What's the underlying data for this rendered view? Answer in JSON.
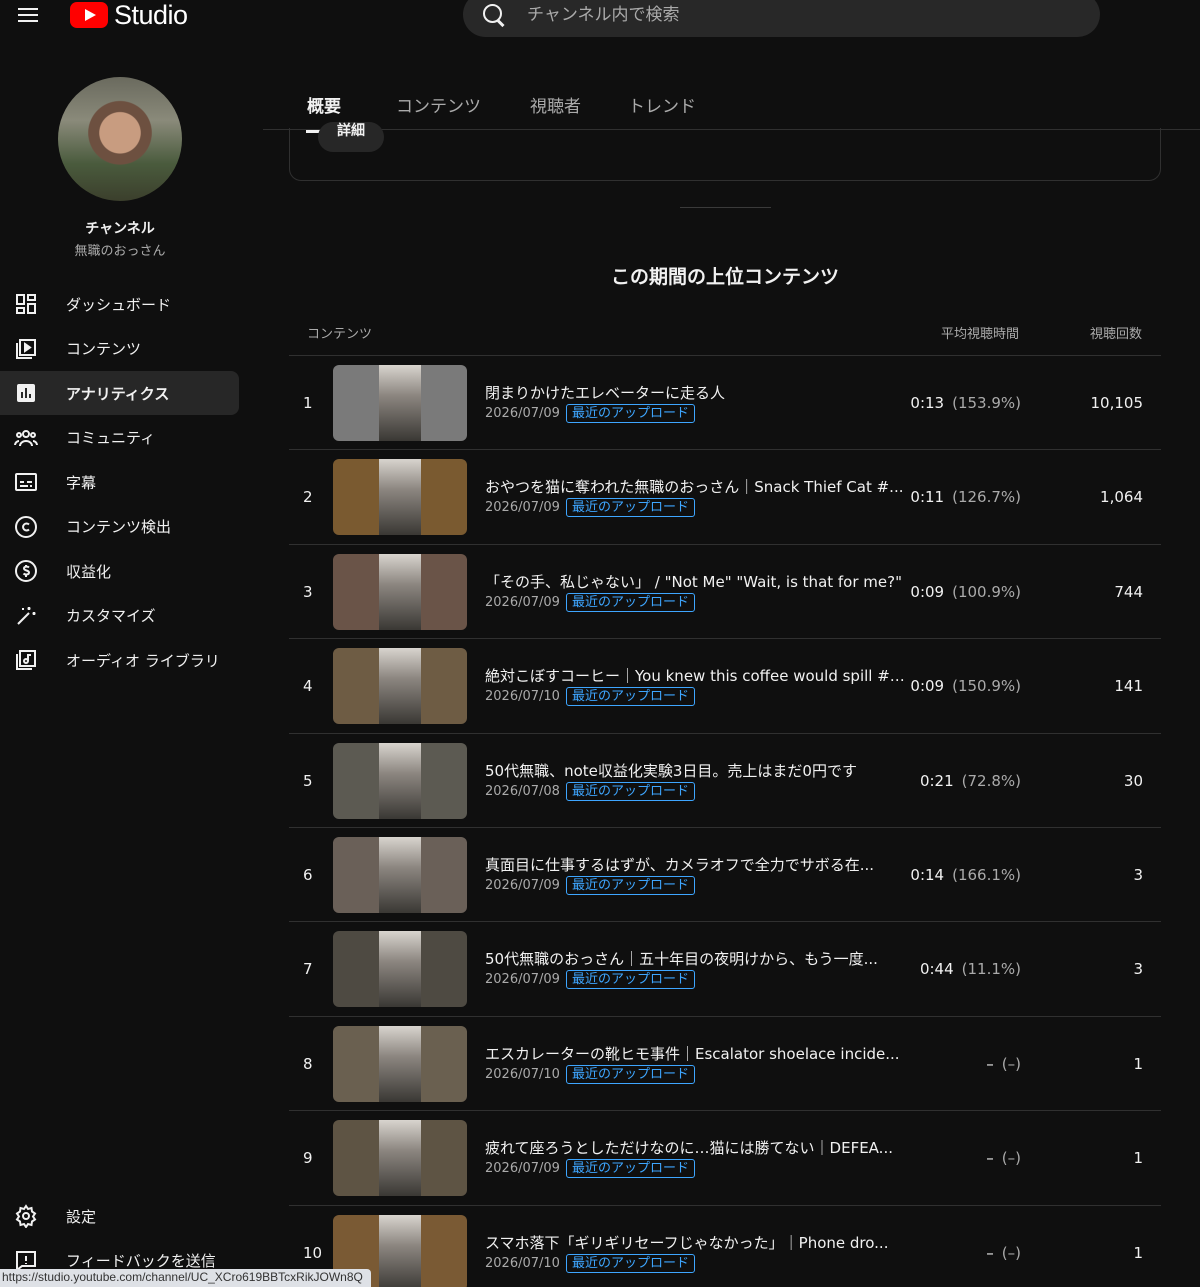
{
  "app": {
    "logo_text": "Studio"
  },
  "search": {
    "placeholder": "チャンネル内で検索"
  },
  "channel": {
    "title": "チャンネル",
    "name": "無職のおっさん"
  },
  "nav": [
    {
      "label": "ダッシュボード",
      "icon": "dashboard-icon"
    },
    {
      "label": "コンテンツ",
      "icon": "content-icon"
    },
    {
      "label": "アナリティクス",
      "icon": "analytics-icon",
      "active": true
    },
    {
      "label": "コミュニティ",
      "icon": "community-icon"
    },
    {
      "label": "字幕",
      "icon": "subtitles-icon"
    },
    {
      "label": "コンテンツ検出",
      "icon": "copyright-icon"
    },
    {
      "label": "収益化",
      "icon": "dollar-icon"
    },
    {
      "label": "カスタマイズ",
      "icon": "magic-wand-icon"
    },
    {
      "label": "オーディオ ライブラリ",
      "icon": "audio-library-icon"
    }
  ],
  "nav_bottom": [
    {
      "label": "設定",
      "icon": "gear-icon"
    },
    {
      "label": "フィードバックを送信",
      "icon": "feedback-icon"
    }
  ],
  "status_url": "https://studio.youtube.com/channel/UC_XCro619BBTcxRikJOWn8Q",
  "tabs": [
    {
      "label": "概要",
      "active": true
    },
    {
      "label": "コンテンツ"
    },
    {
      "label": "視聴者"
    },
    {
      "label": "トレンド"
    }
  ],
  "card": {
    "details_label": "詳細"
  },
  "section": {
    "title": "この期間の上位コンテンツ",
    "col_content": "コンテンツ",
    "col_avg": "平均視聴時間",
    "col_views": "視聴回数"
  },
  "rows": [
    {
      "rank": "1",
      "title": "閉まりかけたエレベーターに走る人",
      "date": "2026/07/09",
      "badge": "最近のアップロード",
      "avg": "0:13",
      "pct": "(153.9%)",
      "views": "10,105",
      "thumb_color": "#7a7a7a"
    },
    {
      "rank": "2",
      "title": "おやつを猫に奪われた無職のおっさん｜Snack Thief Cat #...",
      "date": "2026/07/09",
      "badge": "最近のアップロード",
      "avg": "0:11",
      "pct": "(126.7%)",
      "views": "1,064",
      "thumb_color": "#7a5a30"
    },
    {
      "rank": "3",
      "title": "「その手、私じゃない」 / \"Not Me\" \"Wait, is that for me?\"",
      "date": "2026/07/09",
      "badge": "最近のアップロード",
      "avg": "0:09",
      "pct": "(100.9%)",
      "views": "744",
      "thumb_color": "#6a5448"
    },
    {
      "rank": "4",
      "title": "絶対こぼすコーヒー｜You knew this coffee would spill #s...",
      "date": "2026/07/10",
      "badge": "最近のアップロード",
      "avg": "0:09",
      "pct": "(150.9%)",
      "views": "141",
      "thumb_color": "#6e5c44"
    },
    {
      "rank": "5",
      "title": "50代無職、note収益化実験3日目。売上はまだ0円です",
      "date": "2026/07/08",
      "badge": "最近のアップロード",
      "avg": "0:21",
      "pct": "(72.8%)",
      "views": "30",
      "thumb_color": "#5c5a52"
    },
    {
      "rank": "6",
      "title": "真面目に仕事するはずが、カメラオフで全力でサボる在...",
      "date": "2026/07/09",
      "badge": "最近のアップロード",
      "avg": "0:14",
      "pct": "(166.1%)",
      "views": "3",
      "thumb_color": "#6a6058"
    },
    {
      "rank": "7",
      "title": "50代無職のおっさん｜五十年目の夜明けから、もう一度...",
      "date": "2026/07/09",
      "badge": "最近のアップロード",
      "avg": "0:44",
      "pct": "(11.1%)",
      "views": "3",
      "thumb_color": "#4e4a42"
    },
    {
      "rank": "8",
      "title": "エスカレーターの靴ヒモ事件｜Escalator shoelace incide...",
      "date": "2026/07/10",
      "badge": "最近のアップロード",
      "avg": "–",
      "pct": "(–)",
      "views": "1",
      "thumb_color": "#6a6050"
    },
    {
      "rank": "9",
      "title": "疲れて座ろうとしただけなのに…猫には勝てない｜DEFEA...",
      "date": "2026/07/09",
      "badge": "最近のアップロード",
      "avg": "–",
      "pct": "(–)",
      "views": "1",
      "thumb_color": "#5e5444"
    },
    {
      "rank": "10",
      "title": "スマホ落下「ギリギリセーフじゃなかった」｜Phone dro...",
      "date": "2026/07/10",
      "badge": "最近のアップロード",
      "avg": "–",
      "pct": "(–)",
      "views": "1",
      "thumb_color": "#7a5a34"
    }
  ]
}
